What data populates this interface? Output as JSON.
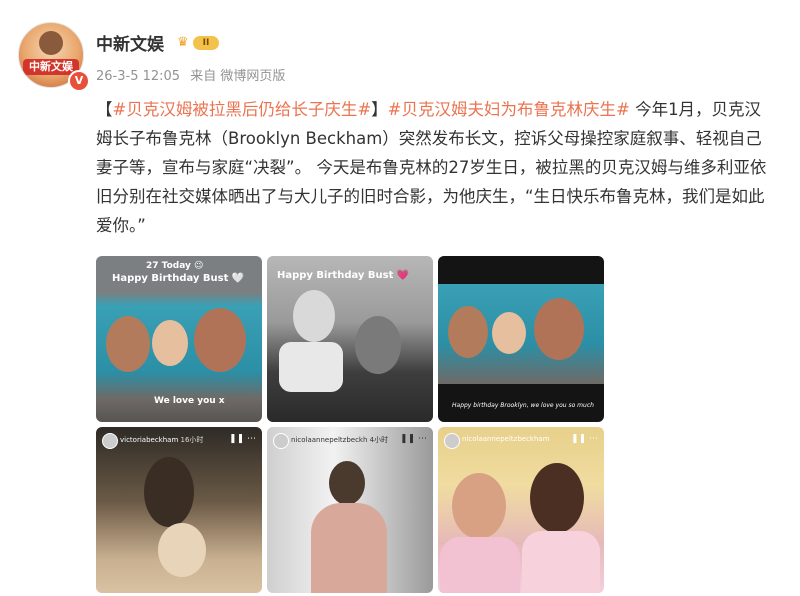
{
  "post": {
    "author": "中新文娱",
    "vip_level": "II",
    "verified_mark": "V",
    "avatar_text": "中新文娱",
    "time": "26-3-5 12:05",
    "source": "来自 微博网页版",
    "bracket_open": "【",
    "tag1": "#贝克汉姆被拉黑后仍给长子庆生#",
    "tag2": "#贝克汉姆夫妇为布鲁克林庆生#",
    "body": "今年1月，贝克汉姆长子布鲁克林（Brooklyn Beckham）突然发布长文，控诉父母操控家庭叙事、轻视自己妻子等，宣布与家庭“决裂”。 今天是布鲁克林的27岁生日，被拉黑的贝克汉姆与维多利亚依旧分别在社交媒体晒出了与大儿子的旧时合影，为他庆生，“生日快乐布鲁克林，我们是如此爱你。”"
  },
  "images": [
    {
      "top_text": "27 Today 😉",
      "title": "Happy Birthday Bust 🤍",
      "bottom": "We love you x"
    },
    {
      "title": "Happy Birthday Bust 💗"
    },
    {
      "bottom": "Happy birthday Brooklyn, we love you so much"
    },
    {
      "account": "victoriabeckham",
      "time": "16小时",
      "controls": "❚❚  ⋯"
    },
    {
      "account": "nicolaannepeltzbeckh",
      "time": "4小时",
      "sub": "",
      "controls": "❚❚  ⋯"
    },
    {
      "account": "nicolaannepeltzbeckham",
      "time": "",
      "controls": "❚❚  ⋯"
    }
  ],
  "colors": {
    "tag": "#eb7350",
    "meta": "#939393",
    "text": "#333333"
  }
}
